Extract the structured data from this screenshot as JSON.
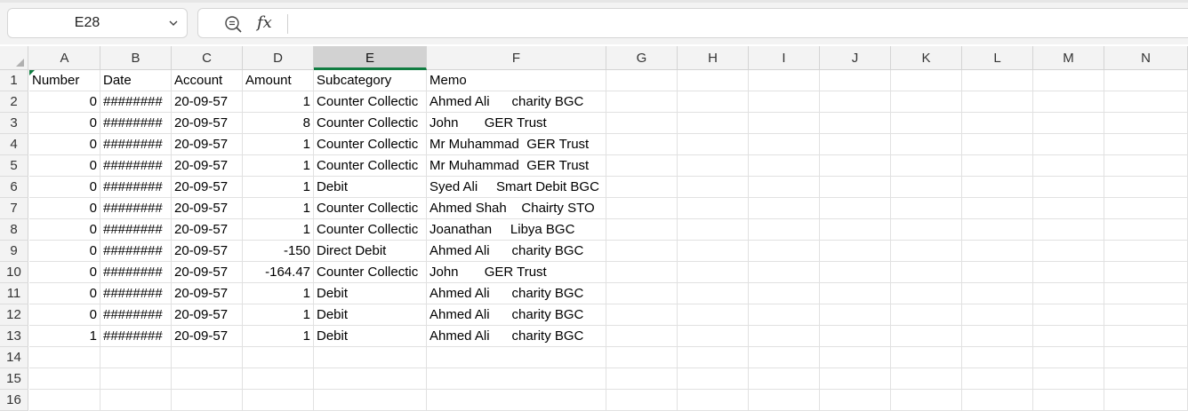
{
  "name_box": {
    "value": "E28"
  },
  "formula_bar": {
    "fx_label": "fx",
    "value": ""
  },
  "columns": [
    "A",
    "B",
    "C",
    "D",
    "E",
    "F",
    "G",
    "H",
    "I",
    "J",
    "K",
    "L",
    "M",
    "N"
  ],
  "selected_column": "E",
  "row_numbers": [
    "1",
    "2",
    "3",
    "4",
    "5",
    "6",
    "7",
    "8",
    "9",
    "10",
    "11",
    "12",
    "13",
    "14",
    "15",
    "16"
  ],
  "rows": [
    [
      "Number",
      "Date",
      "Account",
      "Amount",
      "Subcategory",
      "Memo"
    ],
    [
      "0",
      "########",
      "20-09-57",
      "1",
      "Counter Collectic",
      "Ahmed Ali      charity BGC"
    ],
    [
      "0",
      "########",
      "20-09-57",
      "8",
      "Counter Collectic",
      "John       GER Trust"
    ],
    [
      "0",
      "########",
      "20-09-57",
      "1",
      "Counter Collectic",
      "Mr Muhammad  GER Trust"
    ],
    [
      "0",
      "########",
      "20-09-57",
      "1",
      "Counter Collectic",
      "Mr Muhammad  GER Trust"
    ],
    [
      "0",
      "########",
      "20-09-57",
      "1",
      "Debit",
      "Syed Ali     Smart Debit BGC"
    ],
    [
      "0",
      "########",
      "20-09-57",
      "1",
      "Counter Collectic",
      "Ahmed Shah    Chairty STO"
    ],
    [
      "0",
      "########",
      "20-09-57",
      "1",
      "Counter Collectic",
      "Joanathan     Libya BGC"
    ],
    [
      "0",
      "########",
      "20-09-57",
      "-150",
      "Direct Debit",
      "Ahmed Ali      charity BGC"
    ],
    [
      "0",
      "########",
      "20-09-57",
      "-164.47",
      "Counter Collectic",
      "John       GER Trust"
    ],
    [
      "0",
      "########",
      "20-09-57",
      "1",
      "Debit",
      "Ahmed Ali      charity BGC"
    ],
    [
      "0",
      "########",
      "20-09-57",
      "1",
      "Debit",
      "Ahmed Ali      charity BGC"
    ],
    [
      "1",
      "########",
      "20-09-57",
      "1",
      "Debit",
      "Ahmed Ali      charity BGC"
    ],
    [
      "",
      "",
      "",
      "",
      "",
      ""
    ],
    [
      "",
      "",
      "",
      "",
      "",
      ""
    ],
    [
      "",
      "",
      "",
      "",
      "",
      ""
    ]
  ]
}
